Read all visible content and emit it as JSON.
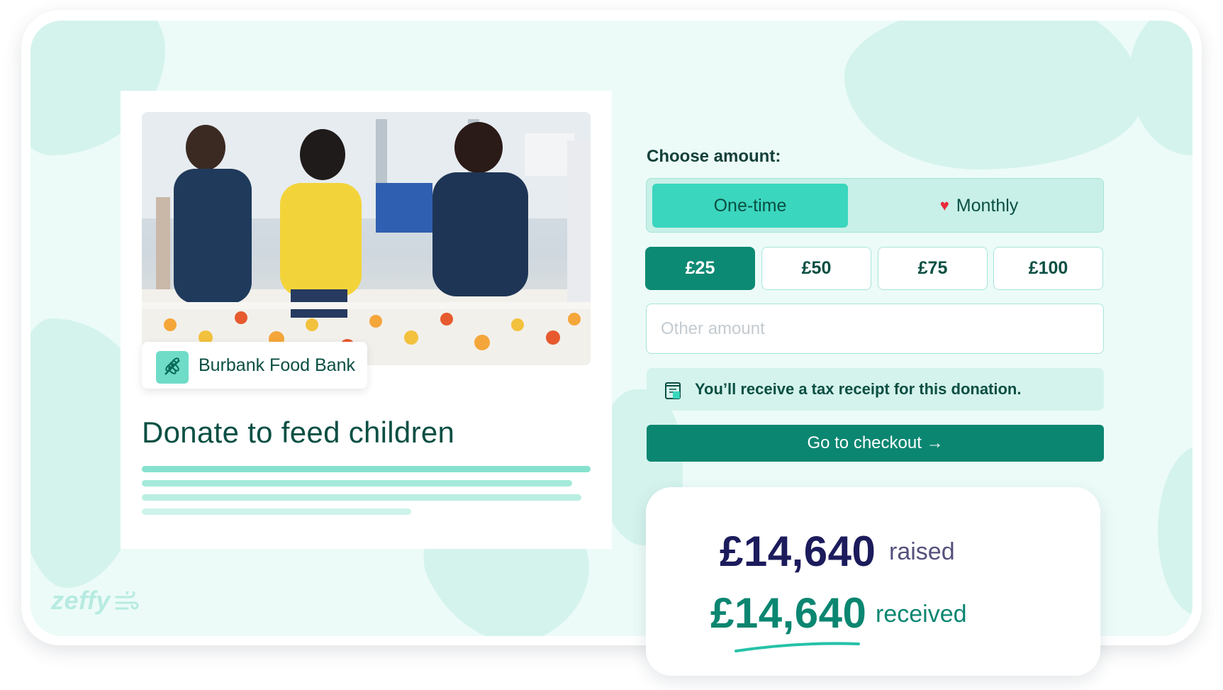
{
  "campaign": {
    "org_name": "Burbank Food Bank",
    "title": "Donate to feed children"
  },
  "form": {
    "choose_label": "Choose amount:",
    "frequency": {
      "one_time_label": "One-time",
      "monthly_label": "Monthly",
      "monthly_icon": "heart-icon",
      "selected": "One-time"
    },
    "amounts": [
      "£25",
      "£50",
      "£75",
      "£100"
    ],
    "selected_amount": "£25",
    "other_amount_placeholder": "Other amount",
    "tax_note": "You’ll receive a tax receipt for this donation.",
    "tax_icon": "receipt-icon",
    "checkout_label": "Go to checkout →"
  },
  "stats": {
    "raised_amount": "£14,640",
    "raised_label": "raised",
    "received_amount": "£14,640",
    "received_label": "received"
  },
  "brand": {
    "name": "zeffy",
    "icon": "wind-icon"
  },
  "colors": {
    "background": "#ecfbf8",
    "accent_light": "#3ad6bd",
    "accent_dark": "#0b8671",
    "heading_dark": "#0a4f43",
    "heart": "#ea2a3a"
  }
}
